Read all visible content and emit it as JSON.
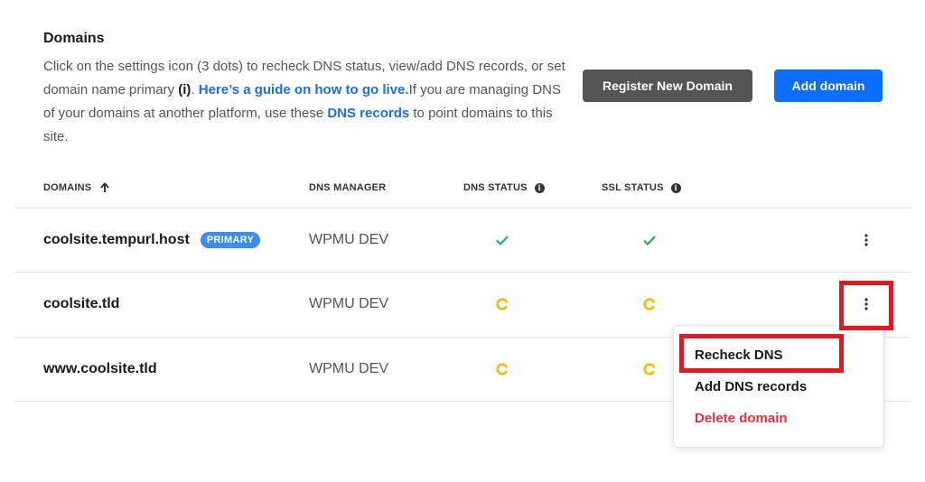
{
  "header": {
    "title": "Domains",
    "desc_part1": "Click on the settings icon (3 dots) to recheck DNS status, view/add DNS records, or set domain name primary ",
    "desc_bold": "(i)",
    "desc_part2": ". ",
    "guide_link": "Here’s a guide on how to go live.",
    "desc_part3": "If you are managing DNS of your domains at another platform, use these ",
    "dns_link": "DNS records",
    "desc_part4": " to point domains to this site."
  },
  "buttons": {
    "register": "Register New Domain",
    "add": "Add domain"
  },
  "table": {
    "col_domains": "DOMAINS",
    "col_dns_manager": "DNS MANAGER",
    "col_dns_status": "DNS STATUS",
    "col_ssl_status": "SSL STATUS",
    "rows": [
      {
        "domain": "coolsite.tempurl.host",
        "badge": "PRIMARY",
        "manager": "WPMU DEV",
        "dns": "ok",
        "ssl": "ok"
      },
      {
        "domain": "coolsite.tld",
        "manager": "WPMU DEV",
        "dns": "pending",
        "ssl": "pending"
      },
      {
        "domain": "www.coolsite.tld",
        "manager": "WPMU DEV",
        "dns": "pending",
        "ssl": "pending"
      }
    ]
  },
  "menu": {
    "recheck": "Recheck DNS",
    "add_records": "Add DNS records",
    "delete": "Delete domain"
  },
  "colors": {
    "ok": "#27b24a",
    "pending": "#f5b800",
    "accent": "#0d6efd",
    "highlight": "#e01a22"
  }
}
